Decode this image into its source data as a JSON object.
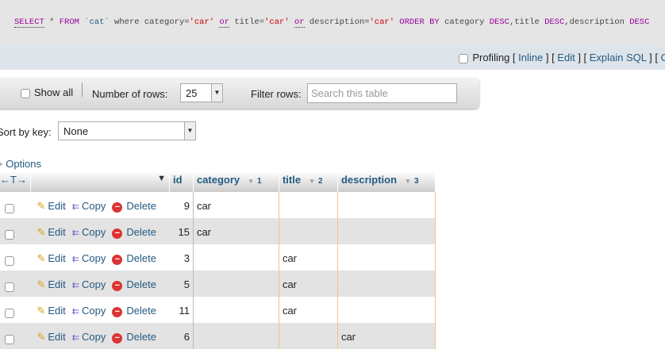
{
  "sql": {
    "select": "SELECT",
    "star": " * ",
    "from": "FROM ",
    "table": "`cat`",
    "where": " where category=",
    "v1": "'car'",
    "or1": "or",
    "t": " title=",
    "v2": "'car'",
    "or2": "or",
    "d": " description=",
    "v3": "'car'",
    "order": " ORDER BY ",
    "c1": "category ",
    "desc1": "DESC",
    "c2": ",title ",
    "desc2": "DESC",
    "c3": ",description ",
    "desc3": "DESC"
  },
  "profiling": {
    "label": "Profiling",
    "links": [
      "Inline",
      "Edit",
      "Explain SQL",
      "C"
    ]
  },
  "nav": {
    "show_all": "Show all",
    "rows_label": "Number of rows:",
    "rows_value": "25",
    "filter_label": "Filter rows:",
    "filter_placeholder": "Search this table"
  },
  "sort": {
    "label": "Sort by key:",
    "value": "None"
  },
  "options_label": "+ Options",
  "table": {
    "columns": [
      {
        "name": "id"
      },
      {
        "name": "category",
        "order": "1"
      },
      {
        "name": "title",
        "order": "2"
      },
      {
        "name": "description",
        "order": "3"
      }
    ],
    "actions": {
      "edit": "Edit",
      "copy": "Copy",
      "delete": "Delete"
    },
    "rows": [
      {
        "id": "9",
        "category": "car",
        "title": "",
        "description": ""
      },
      {
        "id": "15",
        "category": "car",
        "title": "",
        "description": ""
      },
      {
        "id": "3",
        "category": "",
        "title": "car",
        "description": ""
      },
      {
        "id": "5",
        "category": "",
        "title": "car",
        "description": ""
      },
      {
        "id": "11",
        "category": "",
        "title": "car",
        "description": ""
      },
      {
        "id": "6",
        "category": "",
        "title": "",
        "description": "car"
      }
    ]
  }
}
